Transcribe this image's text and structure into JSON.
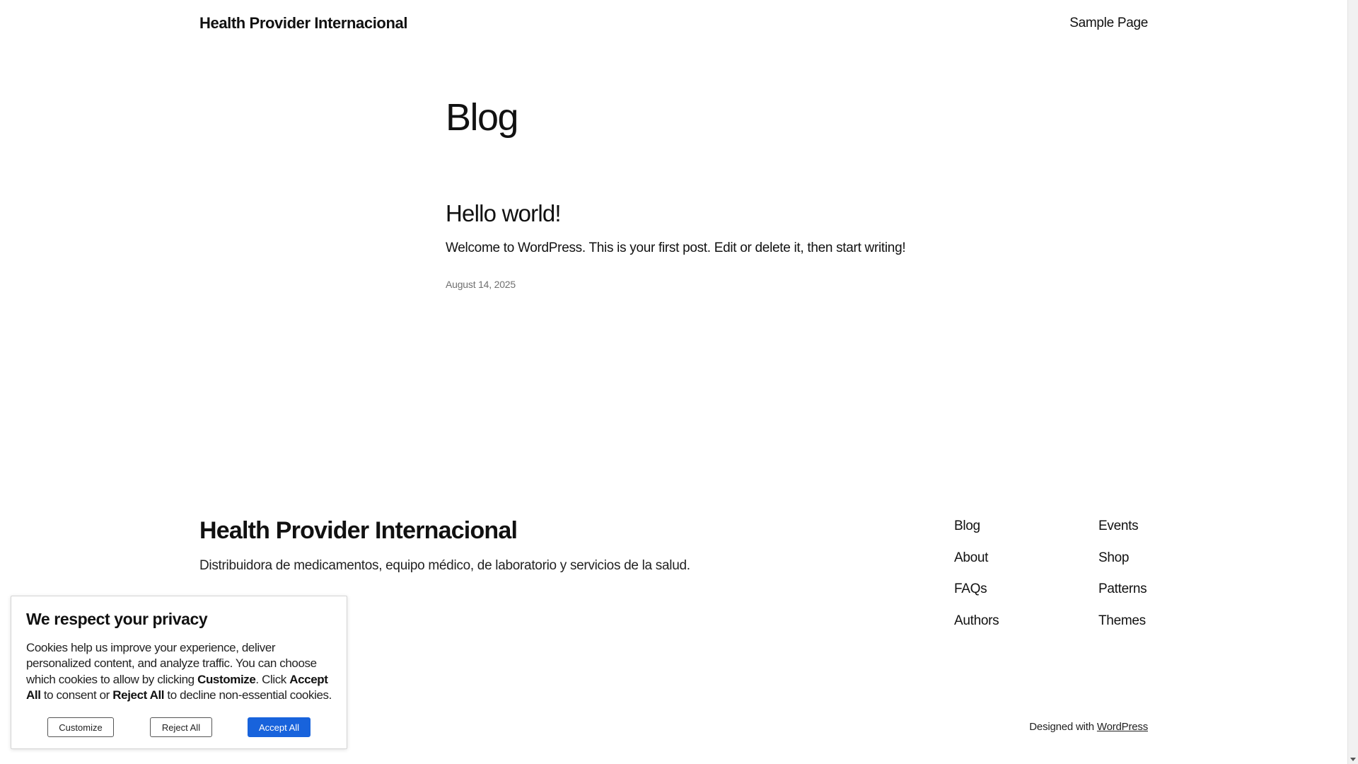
{
  "header": {
    "site_title": "Health Provider Internacional",
    "nav": [
      "Sample Page"
    ]
  },
  "main": {
    "page_heading": "Blog",
    "posts": [
      {
        "title": "Hello world!",
        "excerpt": "Welcome to WordPress. This is your first post. Edit or delete it, then start writing!",
        "date": "August 14, 2025"
      }
    ]
  },
  "footer": {
    "title": "Health Provider Internacional",
    "tagline": "Distribuidora de medicamentos, equipo médico, de laboratorio y servicios de la salud.",
    "nav_col_1": [
      "Blog",
      "About",
      "FAQs",
      "Authors"
    ],
    "nav_col_2": [
      "Events",
      "Shop",
      "Patterns",
      "Themes"
    ],
    "credits_prefix": "Designed with ",
    "credits_link": "WordPress"
  },
  "cookie_banner": {
    "title": "We respect your privacy",
    "body_1": "Cookies help us improve your experience, deliver personalized content, and analyze traffic. You can choose which cookies to allow by clicking ",
    "body_bold_1": "Customize",
    "body_2": ". Click ",
    "body_bold_2": "Accept All",
    "body_3": " to consent or ",
    "body_bold_3": "Reject All",
    "body_4": " to decline non-essential cookies.",
    "buttons": {
      "customize": "Customize",
      "reject": "Reject All",
      "accept": "Accept All"
    },
    "accent_color": "#1863dc"
  }
}
